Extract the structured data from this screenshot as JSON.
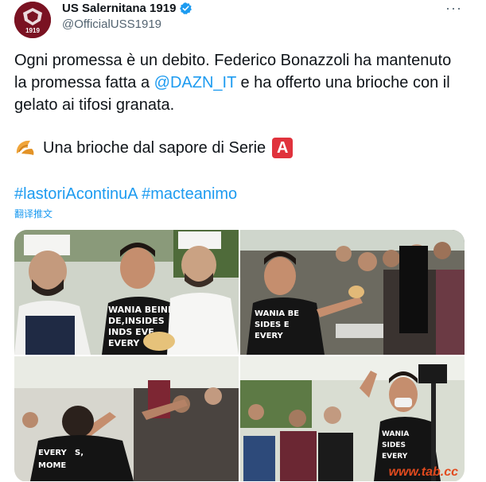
{
  "author": {
    "display_name": "US Salernitana 1919",
    "handle": "@OfficialUSS1919",
    "avatar_text": "1919"
  },
  "tweet": {
    "part1": "Ogni promessa è un debito. Federico Bonazzoli ha mantenuto la promessa fatta a ",
    "mention": "@DAZN_IT",
    "part2": " e ha offerto una brioche con il gelato ai tifosi granata.",
    "line2_text": "Una brioche dal sapore di Serie ",
    "line2_badge": "A",
    "hashtag1": "#lastoriAcontinuA",
    "hashtag2": "#macteanimo",
    "translate_label": "翻译推文"
  },
  "more_label": "···",
  "watermark": "www.tab.cc",
  "colors": {
    "link": "#1d9bf0",
    "accent": "#7a1222",
    "badge": "#e0323c"
  },
  "icons": {
    "verified": "verified-badge-icon",
    "croissant": "croissant-icon",
    "more": "more-icon"
  }
}
